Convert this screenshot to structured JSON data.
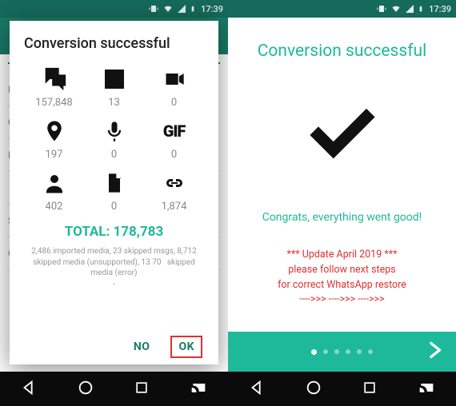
{
  "status": {
    "time": "17:39"
  },
  "left": {
    "dialog_title": "Conversion successful",
    "stats": {
      "chats": "157,848",
      "images": "13",
      "videos": "0",
      "locations": "197",
      "voice": "0",
      "gifs": "0",
      "gif_label": "GIF",
      "contacts": "402",
      "documents": "0",
      "links": "1,874"
    },
    "total_label": "TOTAL: 178,783",
    "footnote": "2,486 imported media, 23 skipped msgs, 8,712 skipped media (unsupported), 13 70   skipped media (error)",
    "dot": "·",
    "btn_no": "NO",
    "btn_ok": "OK",
    "bg_rows": [
      "B",
      "C",
      "D",
      "",
      "S",
      "C"
    ]
  },
  "right": {
    "title": "Conversion successful",
    "congrats": "Congrats, everything went good!",
    "update_l1": "*** Update April 2019 ***",
    "update_l2": "please follow next steps",
    "update_l3": "for correct WhatsApp restore",
    "update_l4": "---->>> ---->>> ---->>>"
  }
}
